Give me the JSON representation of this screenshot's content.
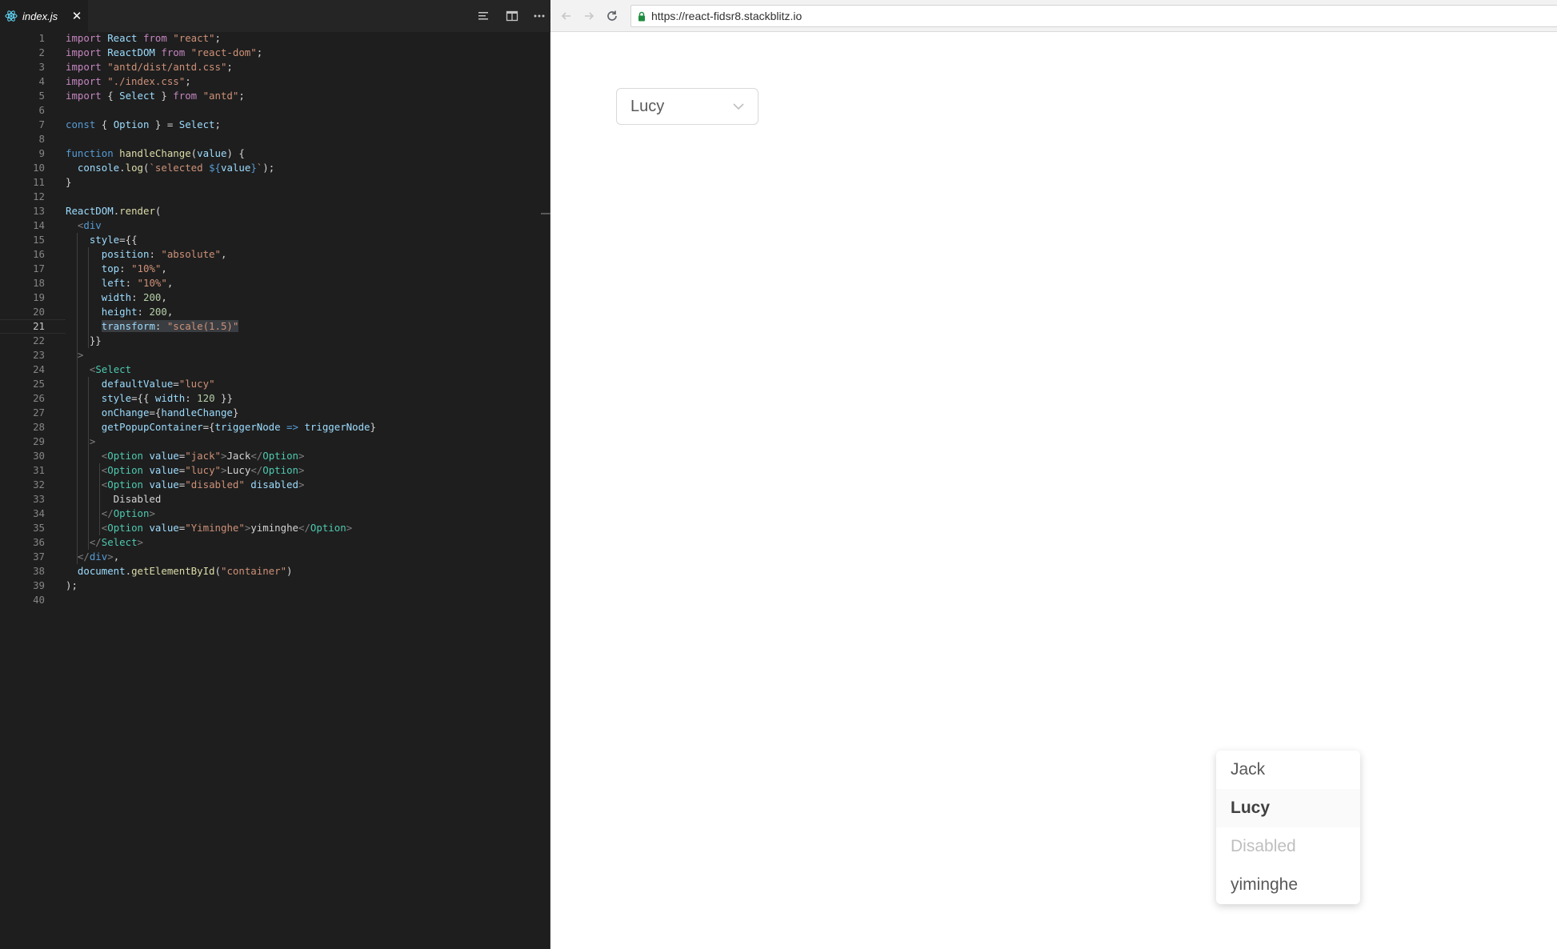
{
  "editor": {
    "tab": {
      "label": "index.js",
      "close": "✕"
    },
    "toolbar_icons": [
      "align-left-icon",
      "split-editor-icon",
      "more-icon"
    ],
    "active_line": 21,
    "lines": [
      {
        "n": "1",
        "t": [
          [
            "kw",
            "import "
          ],
          [
            "va",
            "React "
          ],
          [
            "kw",
            "from "
          ],
          [
            "st",
            "\"react\""
          ],
          [
            "",
            "; "
          ]
        ]
      },
      {
        "n": "2",
        "t": [
          [
            "kw",
            "import "
          ],
          [
            "va",
            "ReactDOM "
          ],
          [
            "kw",
            "from "
          ],
          [
            "st",
            "\"react-dom\""
          ],
          [
            "",
            ";"
          ]
        ]
      },
      {
        "n": "3",
        "t": [
          [
            "kw",
            "import "
          ],
          [
            "st",
            "\"antd/dist/antd.css\""
          ],
          [
            "",
            ";"
          ]
        ]
      },
      {
        "n": "4",
        "t": [
          [
            "kw",
            "import "
          ],
          [
            "st",
            "\"./index.css\""
          ],
          [
            "",
            ";"
          ]
        ]
      },
      {
        "n": "5",
        "t": [
          [
            "kw",
            "import "
          ],
          [
            "",
            "{ "
          ],
          [
            "va",
            "Select "
          ],
          [
            "",
            "} "
          ],
          [
            "kw",
            "from "
          ],
          [
            "st",
            "\"antd\""
          ],
          [
            "",
            ";"
          ]
        ]
      },
      {
        "n": "6",
        "t": []
      },
      {
        "n": "7",
        "t": [
          [
            "bl",
            "const "
          ],
          [
            "",
            "{ "
          ],
          [
            "va",
            "Option "
          ],
          [
            "",
            "} = "
          ],
          [
            "va",
            "Select"
          ],
          [
            "",
            ";"
          ]
        ]
      },
      {
        "n": "8",
        "t": []
      },
      {
        "n": "9",
        "t": [
          [
            "bl",
            "function "
          ],
          [
            "fn",
            "handleChange"
          ],
          [
            "",
            "("
          ],
          [
            "va",
            "value"
          ],
          [
            "",
            ") {"
          ]
        ]
      },
      {
        "n": "10",
        "t": [
          [
            "",
            "  "
          ],
          [
            "va",
            "console"
          ],
          [
            "",
            "."
          ],
          [
            "fn",
            "log"
          ],
          [
            "",
            "("
          ],
          [
            "st",
            "`selected "
          ],
          [
            "bl",
            "${"
          ],
          [
            "va",
            "value"
          ],
          [
            "bl",
            "}"
          ],
          [
            "st",
            "`"
          ],
          [
            "",
            ");"
          ]
        ]
      },
      {
        "n": "11",
        "t": [
          [
            "",
            "}"
          ]
        ]
      },
      {
        "n": "12",
        "t": []
      },
      {
        "n": "13",
        "t": [
          [
            "va",
            "ReactDOM"
          ],
          [
            "",
            "."
          ],
          [
            "fn",
            "render"
          ],
          [
            "",
            "("
          ]
        ]
      },
      {
        "n": "14",
        "t": [
          [
            "",
            "  "
          ],
          [
            "gr",
            "<"
          ],
          [
            "tg",
            "div"
          ]
        ]
      },
      {
        "n": "15",
        "t": [
          [
            "",
            "    "
          ],
          [
            "va",
            "style"
          ],
          [
            "",
            "={{"
          ]
        ]
      },
      {
        "n": "16",
        "t": [
          [
            "",
            "      "
          ],
          [
            "va",
            "position"
          ],
          [
            "",
            ": "
          ],
          [
            "st",
            "\"absolute\""
          ],
          [
            "",
            ","
          ]
        ]
      },
      {
        "n": "17",
        "t": [
          [
            "",
            "      "
          ],
          [
            "va",
            "top"
          ],
          [
            "",
            ": "
          ],
          [
            "st",
            "\"10%\""
          ],
          [
            "",
            ","
          ]
        ]
      },
      {
        "n": "18",
        "t": [
          [
            "",
            "      "
          ],
          [
            "va",
            "left"
          ],
          [
            "",
            ": "
          ],
          [
            "st",
            "\"10%\""
          ],
          [
            "",
            ","
          ]
        ]
      },
      {
        "n": "19",
        "t": [
          [
            "",
            "      "
          ],
          [
            "va",
            "width"
          ],
          [
            "",
            ": "
          ],
          [
            "nu",
            "200"
          ],
          [
            "",
            ","
          ]
        ]
      },
      {
        "n": "20",
        "t": [
          [
            "",
            "      "
          ],
          [
            "va",
            "height"
          ],
          [
            "",
            ": "
          ],
          [
            "nu",
            "200"
          ],
          [
            "",
            ","
          ]
        ]
      },
      {
        "n": "21",
        "t": [
          [
            "",
            "      "
          ],
          [
            "va sel",
            "transform"
          ],
          [
            "sel",
            ": "
          ],
          [
            "st sel",
            "\"scale(1.5)\""
          ]
        ]
      },
      {
        "n": "22",
        "t": [
          [
            "",
            "    }}"
          ]
        ]
      },
      {
        "n": "23",
        "t": [
          [
            "",
            "  "
          ],
          [
            "gr",
            ">"
          ]
        ]
      },
      {
        "n": "24",
        "t": [
          [
            "",
            "    "
          ],
          [
            "gr",
            "<"
          ],
          [
            "ty",
            "Select"
          ]
        ]
      },
      {
        "n": "25",
        "t": [
          [
            "",
            "      "
          ],
          [
            "va",
            "defaultValue"
          ],
          [
            "",
            "="
          ],
          [
            "st",
            "\"lucy\""
          ]
        ]
      },
      {
        "n": "26",
        "t": [
          [
            "",
            "      "
          ],
          [
            "va",
            "style"
          ],
          [
            "",
            "={{ "
          ],
          [
            "va",
            "width"
          ],
          [
            "",
            ": "
          ],
          [
            "nu",
            "120"
          ],
          [
            "",
            " }}"
          ]
        ]
      },
      {
        "n": "27",
        "t": [
          [
            "",
            "      "
          ],
          [
            "va",
            "onChange"
          ],
          [
            "",
            "={"
          ],
          [
            "va",
            "handleChange"
          ],
          [
            "",
            "}"
          ]
        ]
      },
      {
        "n": "28",
        "t": [
          [
            "",
            "      "
          ],
          [
            "va",
            "getPopupContainer"
          ],
          [
            "",
            "={"
          ],
          [
            "va",
            "triggerNode "
          ],
          [
            "bl",
            "=> "
          ],
          [
            "va",
            "triggerNode"
          ],
          [
            "",
            "}"
          ]
        ]
      },
      {
        "n": "29",
        "t": [
          [
            "",
            "    "
          ],
          [
            "gr",
            ">"
          ]
        ]
      },
      {
        "n": "30",
        "t": [
          [
            "",
            "      "
          ],
          [
            "gr",
            "<"
          ],
          [
            "ty",
            "Option "
          ],
          [
            "va",
            "value"
          ],
          [
            "",
            "="
          ],
          [
            "st",
            "\"jack\""
          ],
          [
            "gr",
            ">"
          ],
          [
            "",
            "Jack"
          ],
          [
            "gr",
            "</"
          ],
          [
            "ty",
            "Option"
          ],
          [
            "gr",
            ">"
          ]
        ]
      },
      {
        "n": "31",
        "t": [
          [
            "",
            "      "
          ],
          [
            "gr",
            "<"
          ],
          [
            "ty",
            "Option "
          ],
          [
            "va",
            "value"
          ],
          [
            "",
            "="
          ],
          [
            "st",
            "\"lucy\""
          ],
          [
            "gr",
            ">"
          ],
          [
            "",
            "Lucy"
          ],
          [
            "gr",
            "</"
          ],
          [
            "ty",
            "Option"
          ],
          [
            "gr",
            ">"
          ]
        ]
      },
      {
        "n": "32",
        "t": [
          [
            "",
            "      "
          ],
          [
            "gr",
            "<"
          ],
          [
            "ty",
            "Option "
          ],
          [
            "va",
            "value"
          ],
          [
            "",
            "="
          ],
          [
            "st",
            "\"disabled\" "
          ],
          [
            "va",
            "disabled"
          ],
          [
            "gr",
            ">"
          ]
        ]
      },
      {
        "n": "33",
        "t": [
          [
            "",
            "        Disabled"
          ]
        ]
      },
      {
        "n": "34",
        "t": [
          [
            "",
            "      "
          ],
          [
            "gr",
            "</"
          ],
          [
            "ty",
            "Option"
          ],
          [
            "gr",
            ">"
          ]
        ]
      },
      {
        "n": "35",
        "t": [
          [
            "",
            "      "
          ],
          [
            "gr",
            "<"
          ],
          [
            "ty",
            "Option "
          ],
          [
            "va",
            "value"
          ],
          [
            "",
            "="
          ],
          [
            "st",
            "\"Yiminghe\""
          ],
          [
            "gr",
            ">"
          ],
          [
            "",
            "yiminghe"
          ],
          [
            "gr",
            "</"
          ],
          [
            "ty",
            "Option"
          ],
          [
            "gr",
            ">"
          ]
        ]
      },
      {
        "n": "36",
        "t": [
          [
            "",
            "    "
          ],
          [
            "gr",
            "</"
          ],
          [
            "ty",
            "Select"
          ],
          [
            "gr",
            ">"
          ]
        ]
      },
      {
        "n": "37",
        "t": [
          [
            "",
            "  "
          ],
          [
            "gr",
            "</"
          ],
          [
            "tg",
            "div"
          ],
          [
            "gr",
            ">"
          ],
          [
            "",
            ","
          ]
        ]
      },
      {
        "n": "38",
        "t": [
          [
            "",
            "  "
          ],
          [
            "va",
            "document"
          ],
          [
            "",
            "."
          ],
          [
            "fn",
            "getElementById"
          ],
          [
            "",
            "("
          ],
          [
            "st",
            "\"container\""
          ],
          [
            "",
            ")"
          ]
        ]
      },
      {
        "n": "39",
        "t": [
          [
            "",
            ");"
          ]
        ]
      },
      {
        "n": "40",
        "t": []
      }
    ]
  },
  "browser": {
    "url": "https://react-fidsr8.stackblitz.io",
    "select": {
      "value": "Lucy"
    },
    "dropdown": {
      "items": [
        {
          "label": "Jack",
          "state": "normal"
        },
        {
          "label": "Lucy",
          "state": "selected"
        },
        {
          "label": "Disabled",
          "state": "disabled"
        },
        {
          "label": "yiminghe",
          "state": "normal"
        }
      ]
    }
  },
  "colors": {
    "editor_bg": "#1e1e1e",
    "url_green_lock": "#1e8e3e",
    "disabled_text": "#bfbfbf"
  }
}
